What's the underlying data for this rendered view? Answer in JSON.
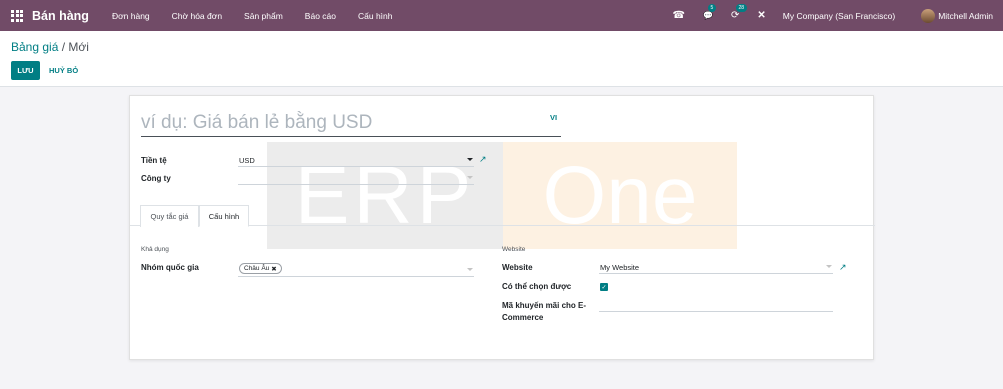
{
  "navbar": {
    "app_name": "Bán hàng",
    "menu": [
      "Đơn hàng",
      "Chờ hóa đơn",
      "Sản phẩm",
      "Báo cáo",
      "Cấu hình"
    ],
    "phone_icon": "☎",
    "chat_icon": "💬",
    "chat_badge": "5",
    "activity_icon": "⟳",
    "activity_badge": "28",
    "debug_icon": "✕",
    "company": "My Company (San Francisco)",
    "user": "Mitchell Admin",
    "bg_color": "#714b67"
  },
  "control": {
    "breadcrumb_parent": "Bảng giá",
    "breadcrumb_sep": "/",
    "breadcrumb_current": "Mới",
    "save_label": "LƯU",
    "discard_label": "HUỶ BỎ",
    "accent": "#017e84"
  },
  "watermark": {
    "left": "ERP",
    "right": "One"
  },
  "form": {
    "name_placeholder": "ví dụ: Giá bán lẻ bằng USD",
    "lang_button": "VI",
    "currency_label": "Tiền tệ",
    "currency_value": "USD",
    "company_label": "Công ty",
    "company_value": "",
    "tabs": [
      "Quy tắc giá",
      "Cấu hình"
    ],
    "active_tab": "Cấu hình",
    "availability_section": "Khả dụng",
    "country_groups_label": "Nhóm quốc gia",
    "country_group_tag": "Châu Âu",
    "tag_remove_icon": "✖",
    "website_section": "Website",
    "website_label": "Website",
    "website_value": "My Website",
    "selectable_label": "Có thể chọn được",
    "selectable_checked": true,
    "ecommerce_label_line1": "Mã khuyến mãi cho E-",
    "ecommerce_label_line2": "Commerce",
    "ecommerce_value": ""
  }
}
